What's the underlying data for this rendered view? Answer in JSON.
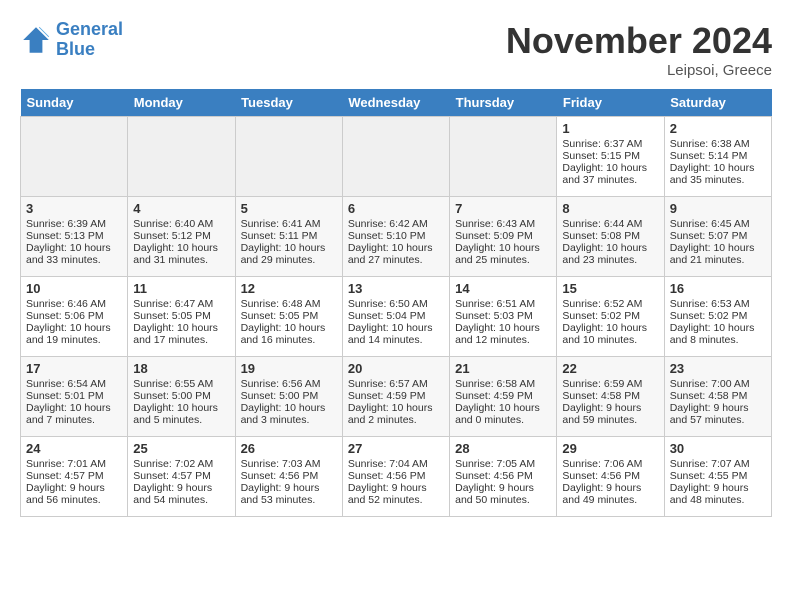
{
  "header": {
    "logo_line1": "General",
    "logo_line2": "Blue",
    "month": "November 2024",
    "location": "Leipsoi, Greece"
  },
  "days_of_week": [
    "Sunday",
    "Monday",
    "Tuesday",
    "Wednesday",
    "Thursday",
    "Friday",
    "Saturday"
  ],
  "weeks": [
    [
      {
        "day": "",
        "empty": true
      },
      {
        "day": "",
        "empty": true
      },
      {
        "day": "",
        "empty": true
      },
      {
        "day": "",
        "empty": true
      },
      {
        "day": "",
        "empty": true
      },
      {
        "day": "1",
        "sunrise": "Sunrise: 6:37 AM",
        "sunset": "Sunset: 5:15 PM",
        "daylight": "Daylight: 10 hours and 37 minutes."
      },
      {
        "day": "2",
        "sunrise": "Sunrise: 6:38 AM",
        "sunset": "Sunset: 5:14 PM",
        "daylight": "Daylight: 10 hours and 35 minutes."
      }
    ],
    [
      {
        "day": "3",
        "sunrise": "Sunrise: 6:39 AM",
        "sunset": "Sunset: 5:13 PM",
        "daylight": "Daylight: 10 hours and 33 minutes."
      },
      {
        "day": "4",
        "sunrise": "Sunrise: 6:40 AM",
        "sunset": "Sunset: 5:12 PM",
        "daylight": "Daylight: 10 hours and 31 minutes."
      },
      {
        "day": "5",
        "sunrise": "Sunrise: 6:41 AM",
        "sunset": "Sunset: 5:11 PM",
        "daylight": "Daylight: 10 hours and 29 minutes."
      },
      {
        "day": "6",
        "sunrise": "Sunrise: 6:42 AM",
        "sunset": "Sunset: 5:10 PM",
        "daylight": "Daylight: 10 hours and 27 minutes."
      },
      {
        "day": "7",
        "sunrise": "Sunrise: 6:43 AM",
        "sunset": "Sunset: 5:09 PM",
        "daylight": "Daylight: 10 hours and 25 minutes."
      },
      {
        "day": "8",
        "sunrise": "Sunrise: 6:44 AM",
        "sunset": "Sunset: 5:08 PM",
        "daylight": "Daylight: 10 hours and 23 minutes."
      },
      {
        "day": "9",
        "sunrise": "Sunrise: 6:45 AM",
        "sunset": "Sunset: 5:07 PM",
        "daylight": "Daylight: 10 hours and 21 minutes."
      }
    ],
    [
      {
        "day": "10",
        "sunrise": "Sunrise: 6:46 AM",
        "sunset": "Sunset: 5:06 PM",
        "daylight": "Daylight: 10 hours and 19 minutes."
      },
      {
        "day": "11",
        "sunrise": "Sunrise: 6:47 AM",
        "sunset": "Sunset: 5:05 PM",
        "daylight": "Daylight: 10 hours and 17 minutes."
      },
      {
        "day": "12",
        "sunrise": "Sunrise: 6:48 AM",
        "sunset": "Sunset: 5:05 PM",
        "daylight": "Daylight: 10 hours and 16 minutes."
      },
      {
        "day": "13",
        "sunrise": "Sunrise: 6:50 AM",
        "sunset": "Sunset: 5:04 PM",
        "daylight": "Daylight: 10 hours and 14 minutes."
      },
      {
        "day": "14",
        "sunrise": "Sunrise: 6:51 AM",
        "sunset": "Sunset: 5:03 PM",
        "daylight": "Daylight: 10 hours and 12 minutes."
      },
      {
        "day": "15",
        "sunrise": "Sunrise: 6:52 AM",
        "sunset": "Sunset: 5:02 PM",
        "daylight": "Daylight: 10 hours and 10 minutes."
      },
      {
        "day": "16",
        "sunrise": "Sunrise: 6:53 AM",
        "sunset": "Sunset: 5:02 PM",
        "daylight": "Daylight: 10 hours and 8 minutes."
      }
    ],
    [
      {
        "day": "17",
        "sunrise": "Sunrise: 6:54 AM",
        "sunset": "Sunset: 5:01 PM",
        "daylight": "Daylight: 10 hours and 7 minutes."
      },
      {
        "day": "18",
        "sunrise": "Sunrise: 6:55 AM",
        "sunset": "Sunset: 5:00 PM",
        "daylight": "Daylight: 10 hours and 5 minutes."
      },
      {
        "day": "19",
        "sunrise": "Sunrise: 6:56 AM",
        "sunset": "Sunset: 5:00 PM",
        "daylight": "Daylight: 10 hours and 3 minutes."
      },
      {
        "day": "20",
        "sunrise": "Sunrise: 6:57 AM",
        "sunset": "Sunset: 4:59 PM",
        "daylight": "Daylight: 10 hours and 2 minutes."
      },
      {
        "day": "21",
        "sunrise": "Sunrise: 6:58 AM",
        "sunset": "Sunset: 4:59 PM",
        "daylight": "Daylight: 10 hours and 0 minutes."
      },
      {
        "day": "22",
        "sunrise": "Sunrise: 6:59 AM",
        "sunset": "Sunset: 4:58 PM",
        "daylight": "Daylight: 9 hours and 59 minutes."
      },
      {
        "day": "23",
        "sunrise": "Sunrise: 7:00 AM",
        "sunset": "Sunset: 4:58 PM",
        "daylight": "Daylight: 9 hours and 57 minutes."
      }
    ],
    [
      {
        "day": "24",
        "sunrise": "Sunrise: 7:01 AM",
        "sunset": "Sunset: 4:57 PM",
        "daylight": "Daylight: 9 hours and 56 minutes."
      },
      {
        "day": "25",
        "sunrise": "Sunrise: 7:02 AM",
        "sunset": "Sunset: 4:57 PM",
        "daylight": "Daylight: 9 hours and 54 minutes."
      },
      {
        "day": "26",
        "sunrise": "Sunrise: 7:03 AM",
        "sunset": "Sunset: 4:56 PM",
        "daylight": "Daylight: 9 hours and 53 minutes."
      },
      {
        "day": "27",
        "sunrise": "Sunrise: 7:04 AM",
        "sunset": "Sunset: 4:56 PM",
        "daylight": "Daylight: 9 hours and 52 minutes."
      },
      {
        "day": "28",
        "sunrise": "Sunrise: 7:05 AM",
        "sunset": "Sunset: 4:56 PM",
        "daylight": "Daylight: 9 hours and 50 minutes."
      },
      {
        "day": "29",
        "sunrise": "Sunrise: 7:06 AM",
        "sunset": "Sunset: 4:56 PM",
        "daylight": "Daylight: 9 hours and 49 minutes."
      },
      {
        "day": "30",
        "sunrise": "Sunrise: 7:07 AM",
        "sunset": "Sunset: 4:55 PM",
        "daylight": "Daylight: 9 hours and 48 minutes."
      }
    ]
  ]
}
